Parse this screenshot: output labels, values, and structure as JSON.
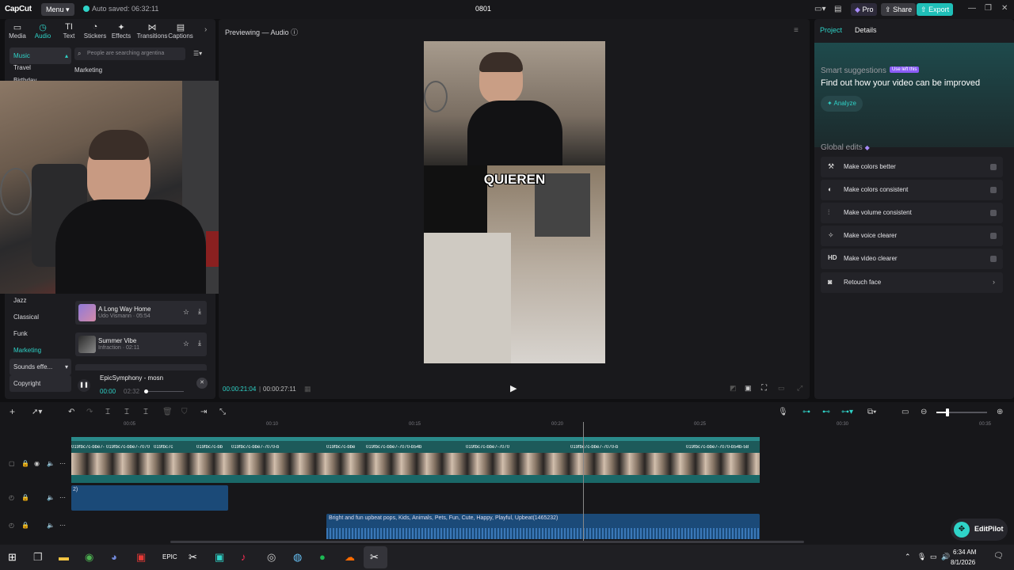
{
  "topbar": {
    "logo": "CapCut",
    "menu": "Menu",
    "autosave": "Auto saved: 06:32:11",
    "project": "0801",
    "pro": "Pro",
    "share": "Share",
    "export": "Export"
  },
  "tabs": [
    {
      "icon": "▭",
      "label": "Media"
    },
    {
      "icon": "◷",
      "label": "Audio"
    },
    {
      "icon": "TI",
      "label": "Text"
    },
    {
      "icon": "◔",
      "label": "Stickers"
    },
    {
      "icon": "✦",
      "label": "Effects"
    },
    {
      "icon": "⋈",
      "label": "Transitions"
    },
    {
      "icon": "▤",
      "label": "Captions"
    }
  ],
  "categories": [
    "Music",
    "Travel",
    "Birthday",
    "Jazz",
    "Classical",
    "Funk",
    "Marketing",
    "Sounds effe...",
    "Copyright"
  ],
  "search_placeholder": "People are searching argentina",
  "section_title": "Marketing",
  "songs": [
    {
      "name": "A Long Way Home",
      "meta": "Udo Vismann · 05:54"
    },
    {
      "name": "Summer Vibe",
      "meta": "Infraction · 02:11"
    }
  ],
  "player": {
    "name": "EpicSymphony - mosn",
    "current": "00:00",
    "total": "02:32"
  },
  "preview": {
    "label": "Previewing — Audio",
    "caption": "QUIEREN",
    "time_current": "00:00:21:04",
    "time_total": "00:00:27:11"
  },
  "right": {
    "tab_project": "Project",
    "tab_details": "Details",
    "smart_title": "Smart suggestions",
    "smart_badge": "Use left this",
    "smart_desc": "Find out how your video can be improved",
    "analyze": "Analyze",
    "global_title": "Global edits",
    "edits": [
      {
        "icon": "⚒",
        "label": "Make colors better"
      },
      {
        "icon": "◐",
        "label": "Make colors consistent"
      },
      {
        "icon": "⫶",
        "label": "Make volume consistent"
      },
      {
        "icon": "✧",
        "label": "Make voice clearer"
      },
      {
        "icon": "HD",
        "label": "Make video clearer"
      },
      {
        "icon": "◙",
        "label": "Retouch face"
      }
    ]
  },
  "ruler": [
    "00:05",
    "00:10",
    "00:15",
    "00:20",
    "00:25",
    "00:30",
    "00:35"
  ],
  "clips": [
    "019fbc7c-bbe7-",
    "019fbc7c-bbe7-7070",
    "019fbc7c",
    "019fbc7c-bb",
    "019fbc7c-bbe7-7070-b",
    "019fbc7c-bbe",
    "019fbc7c-bbe7-7070-b54b",
    "019fbc7c-bbe7-7070",
    "019fbc7c-bbe7-7070-b",
    "019fbc7c-bbe7-7070-b54b-58"
  ],
  "audio1_label": "2)",
  "audio2_label": "Bright and fun upbeat pops, Kids, Animals, Pets, Fun, Cute, Happy, Playful, Upbeat(1465232)",
  "editpilot": "EditPilot",
  "taskbar": {
    "time": "6:34 AM",
    "date": "8/1/2026"
  },
  "colors": {
    "accent": "#2fd3c8",
    "audio_clip": "#1b4a78",
    "video_track": "#1d5a5a"
  }
}
